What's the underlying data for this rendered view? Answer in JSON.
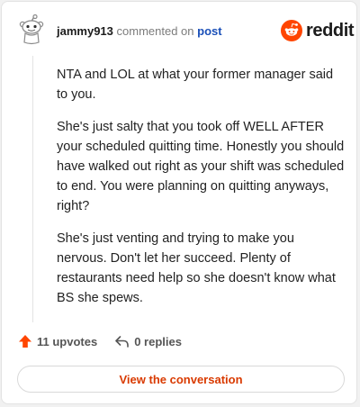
{
  "header": {
    "username": "jammy913",
    "action_text": "commented on",
    "post_link": "post"
  },
  "brand": {
    "name": "reddit",
    "logo_icon": "reddit-snoo-icon",
    "accent_color": "#ff4500"
  },
  "comment": {
    "paragraphs": [
      "NTA and LOL at what your former manager said to you.",
      "She's just salty that you took off WELL AFTER your scheduled quitting time. Honestly you should have walked out right as your shift was scheduled to end. You were planning on quitting anyways, right?",
      "She's just venting and trying to make you nervous. Don't let her succeed. Plenty of restaurants need help so she doesn't know what BS she spews."
    ]
  },
  "actions": {
    "upvotes_label": "11 upvotes",
    "upvote_icon": "upvote-arrow-icon",
    "replies_label": "0 replies",
    "reply_icon": "reply-arrow-icon"
  },
  "cta": {
    "label": "View the conversation",
    "color": "#d93a00"
  }
}
